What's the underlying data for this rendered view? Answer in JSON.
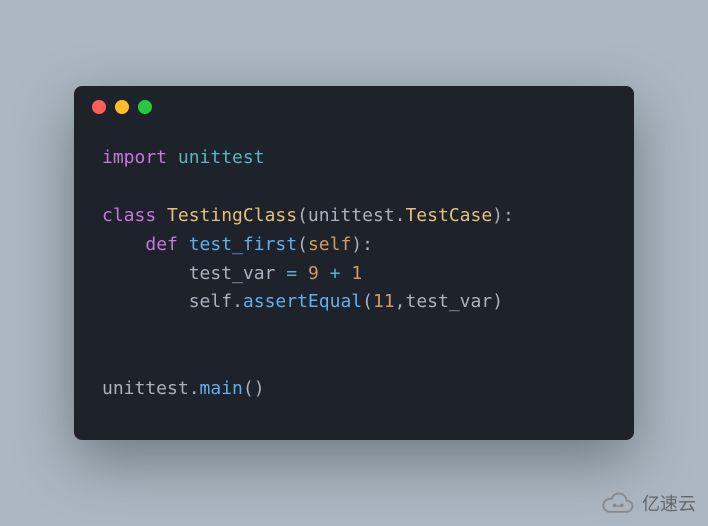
{
  "code": {
    "line1": {
      "kw": "import",
      "mod": "unittest"
    },
    "line3": {
      "kw": "class",
      "cls": "TestingClass",
      "base_mod": "unittest",
      "base_cls": "TestCase"
    },
    "line4": {
      "kw": "def",
      "fn": "test_first",
      "param": "self"
    },
    "line5": {
      "var": "test_var",
      "op": "=",
      "n1": "9",
      "plus": "+",
      "n2": "1"
    },
    "line6": {
      "self": "self",
      "method": "assertEqual",
      "arg1": "11",
      "arg2": "test_var"
    },
    "line9": {
      "mod": "unittest",
      "fn": "main"
    }
  },
  "watermark": "亿速云"
}
